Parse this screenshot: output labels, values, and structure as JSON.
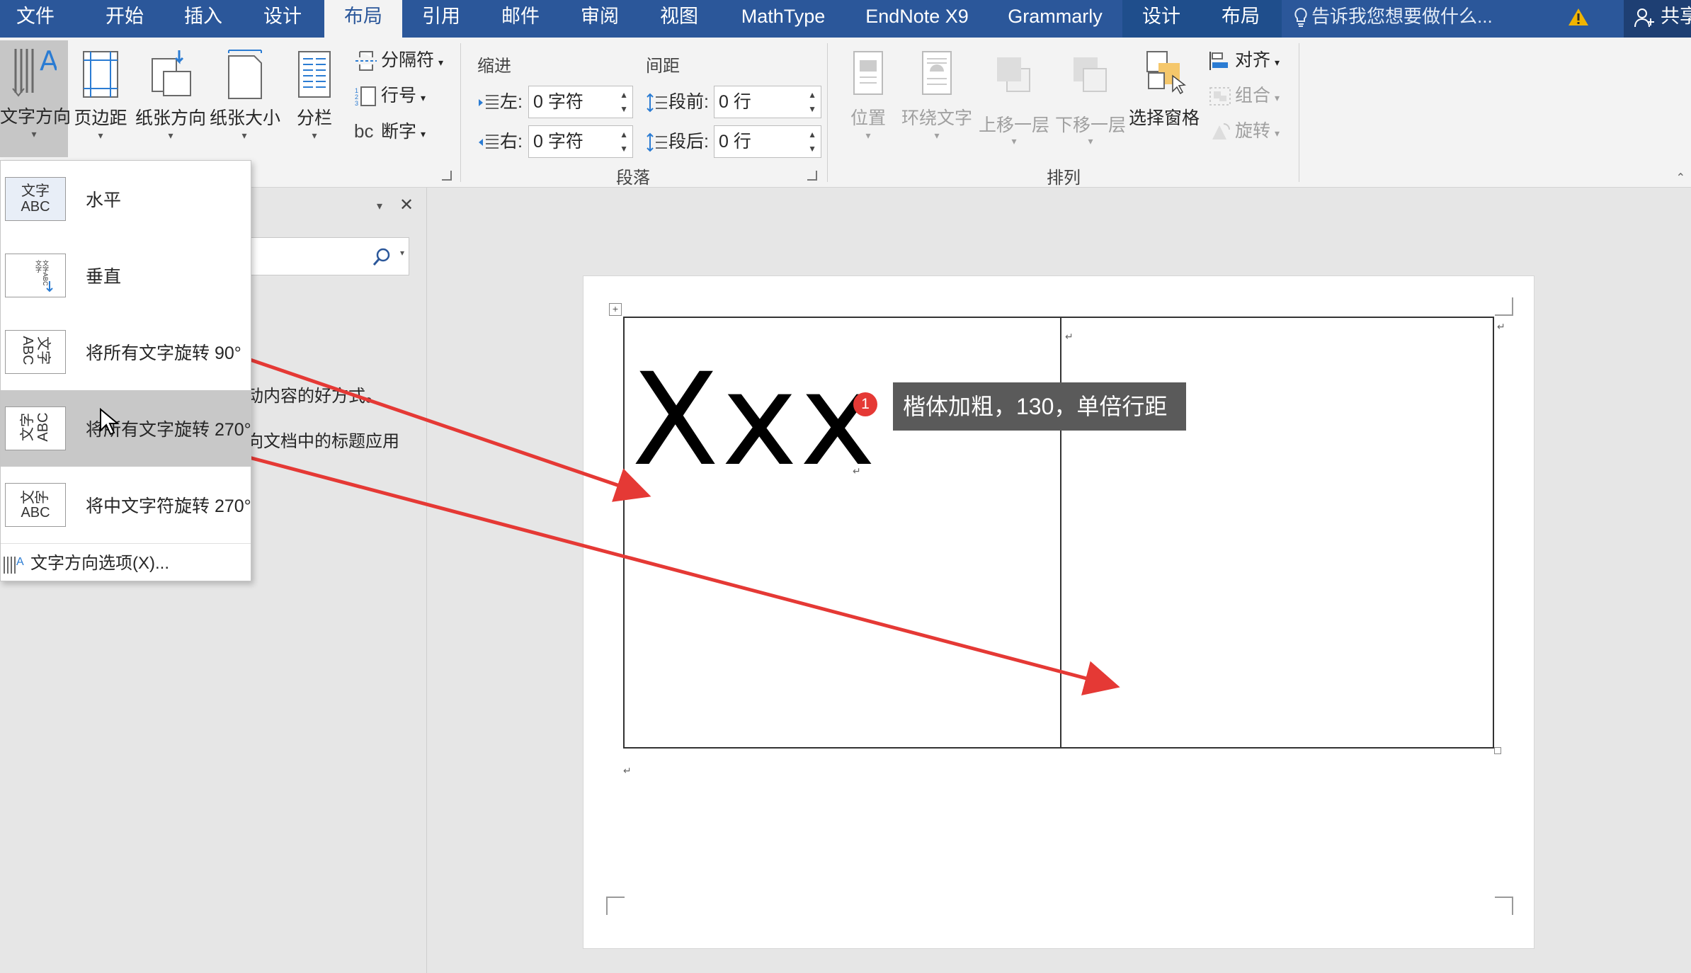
{
  "menubar": {
    "tabs": [
      "文件",
      "开始",
      "插入",
      "设计",
      "布局",
      "引用",
      "邮件",
      "审阅",
      "视图",
      "MathType",
      "EndNote X9",
      "Grammarly",
      "设计",
      "布局"
    ],
    "active_tab": "布局",
    "tell_me": "告诉我您想要做什么...",
    "share": "共享",
    "colors": {
      "bar": "#2b579a",
      "context": "#1f4e8c",
      "warning": "#f0b400"
    }
  },
  "ribbon": {
    "page_setup": {
      "text_direction": "文字方向",
      "margins": "页边距",
      "orientation": "纸张方向",
      "size": "纸张大小",
      "columns": "分栏",
      "breaks": "分隔符",
      "line_numbers": "行号",
      "hyphenation": "断字",
      "hyphenation_icon": "bc"
    },
    "paragraph": {
      "indent_title": "缩进",
      "spacing_title": "间距",
      "left_label": "左:",
      "left_value": "0 字符",
      "right_label": "右:",
      "right_value": "0 字符",
      "before_label": "段前:",
      "before_value": "0 行",
      "after_label": "段后:",
      "after_value": "0 行",
      "group_label": "段落"
    },
    "arrange": {
      "position": "位置",
      "wrap_text": "环绕文字",
      "bring_forward": "上移一层",
      "send_backward": "下移一层",
      "selection_pane": "选择窗格",
      "align": "对齐",
      "group": "组合",
      "rotate": "旋转",
      "group_label": "排列"
    }
  },
  "dropdown": {
    "items": [
      {
        "label": "水平",
        "thumb": "文字\nABC"
      },
      {
        "label": "垂直",
        "thumb": "文字ABC"
      },
      {
        "label": "将所有文字旋转 90°",
        "thumb": "文字\nABC"
      },
      {
        "label": "将所有文字旋转 270°",
        "thumb": "文字\nABC"
      },
      {
        "label": "将中文字符旋转 270°",
        "thumb": "文字\nABC"
      }
    ],
    "selected_item": "水平",
    "hovered_item": "将所有文字旋转 270°",
    "options_label": "文字方向选项(X)..."
  },
  "nav_pane": {
    "text_line1": "动内容的好方式。",
    "text_line2": "向文档中的标题应用"
  },
  "document": {
    "cell_text": "Xxx",
    "callout_number": "1",
    "callout_text": "楷体加粗，130，单倍行距",
    "colors": {
      "annotation_red": "#e53935",
      "tooltip_bg": "#5a5a5a"
    }
  }
}
